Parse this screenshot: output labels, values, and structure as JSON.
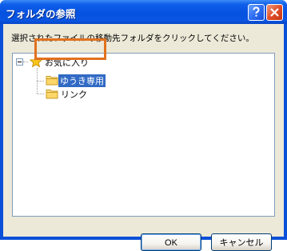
{
  "window": {
    "title": "フォルダの参照"
  },
  "instruction": "選択されたファイルの移動先フォルダをクリックしてください。",
  "tree": {
    "root": {
      "label": "お気に入り",
      "icon": "star-icon"
    },
    "children": [
      {
        "label": "ゆうき専用",
        "icon": "folder-icon",
        "selected": true
      },
      {
        "label": "リンク",
        "icon": "folder-icon",
        "selected": false
      }
    ]
  },
  "buttons": {
    "ok": "OK",
    "cancel": "キャンセル"
  },
  "colors": {
    "titlebar": "#0552e0",
    "selection": "#316ac5",
    "highlight": "#e2711f",
    "dialog_bg": "#ece9d8"
  }
}
